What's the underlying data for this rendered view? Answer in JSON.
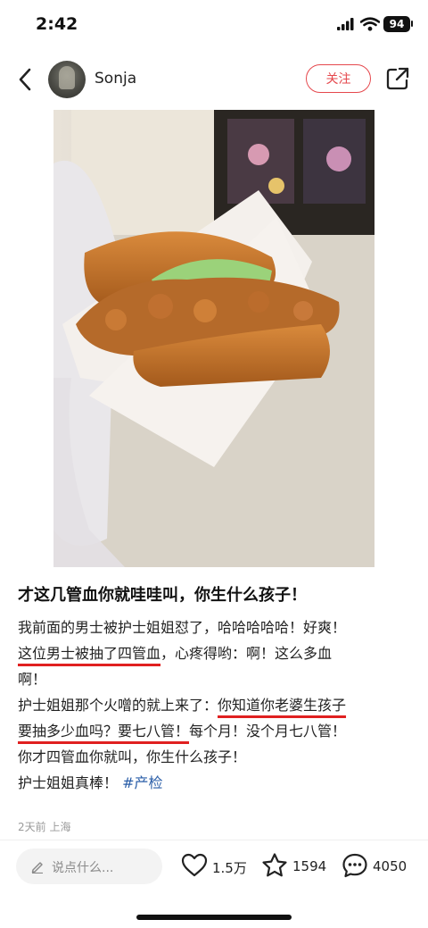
{
  "status": {
    "time": "2:42",
    "battery": "94"
  },
  "header": {
    "username": "Sonja",
    "follow_label": "关注"
  },
  "post": {
    "title": "才这几管血你就哇哇叫，你生什么孩子！",
    "lines": {
      "l1": "我前面的男士被护士姐姐怼了，哈哈哈哈哈！好爽！",
      "l2a": "这位男士被抽了四管血",
      "l2b": "，心疼得哟：啊！这么多血",
      "l3": "啊！",
      "l4a": "护士姐姐那个火噌的就上来了：",
      "l4b": "你知道你老婆生孩子",
      "l5a": "要抽多少血吗？要七八管！",
      "l5b": "每个月！没个月七八管！",
      "l6": "你才四管血你就叫，你生什么孩子！",
      "l7a": "护士姐姐真棒！ ",
      "hashtag": "#产检"
    },
    "meta": "2天前 上海"
  },
  "bottom": {
    "comment_placeholder": "说点什么...",
    "likes": "1.5万",
    "favorites": "1594",
    "comments": "4050"
  },
  "icons": [
    "back-icon",
    "share-icon",
    "heart-icon",
    "star-icon",
    "comment-icon",
    "pencil-icon"
  ],
  "colors": {
    "accent": "#e5484d",
    "underline": "#e02020",
    "hashtag": "#2a5ea8"
  }
}
